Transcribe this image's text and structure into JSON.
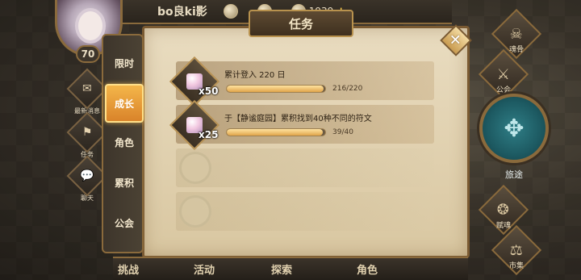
{
  "header": {
    "player_name": "bo良ki影",
    "currency1": "",
    "currency2": "",
    "currency3_value": "1939",
    "plus_symbol": "+"
  },
  "player": {
    "level": "70"
  },
  "left_icons": [
    {
      "label": "最新消息",
      "icon": "scroll-icon",
      "glyph": "✉"
    },
    {
      "label": "任务",
      "icon": "quest-icon",
      "glyph": "⚑"
    },
    {
      "label": "聊天",
      "icon": "chat-icon",
      "glyph": "💬"
    }
  ],
  "tabs": [
    {
      "label": "限时",
      "active": false
    },
    {
      "label": "成长",
      "active": true
    },
    {
      "label": "角色",
      "active": false
    },
    {
      "label": "累积",
      "active": false
    },
    {
      "label": "公会",
      "active": false
    }
  ],
  "panel": {
    "title": "任务",
    "close_glyph": "✕"
  },
  "quests": [
    {
      "text": "累计登入 220 日",
      "reward_qty": "x50",
      "progress_text": "216/220",
      "progress": 0.982
    },
    {
      "text": "于【静谧庭园】累积找到40种不同的符文",
      "reward_qty": "x25",
      "progress_text": "39/40",
      "progress": 0.975
    }
  ],
  "bottom_tabs": [
    "挑战",
    "活动",
    "探索",
    "角色"
  ],
  "right_menu": [
    {
      "label": "魂骨",
      "glyph": "☠"
    },
    {
      "label": "公会",
      "glyph": "⚔"
    },
    {
      "label": "赋魂",
      "glyph": "❂"
    },
    {
      "label": "市集",
      "glyph": "⚖"
    }
  ],
  "journey": {
    "label": "旅途",
    "glyph": "✥"
  }
}
